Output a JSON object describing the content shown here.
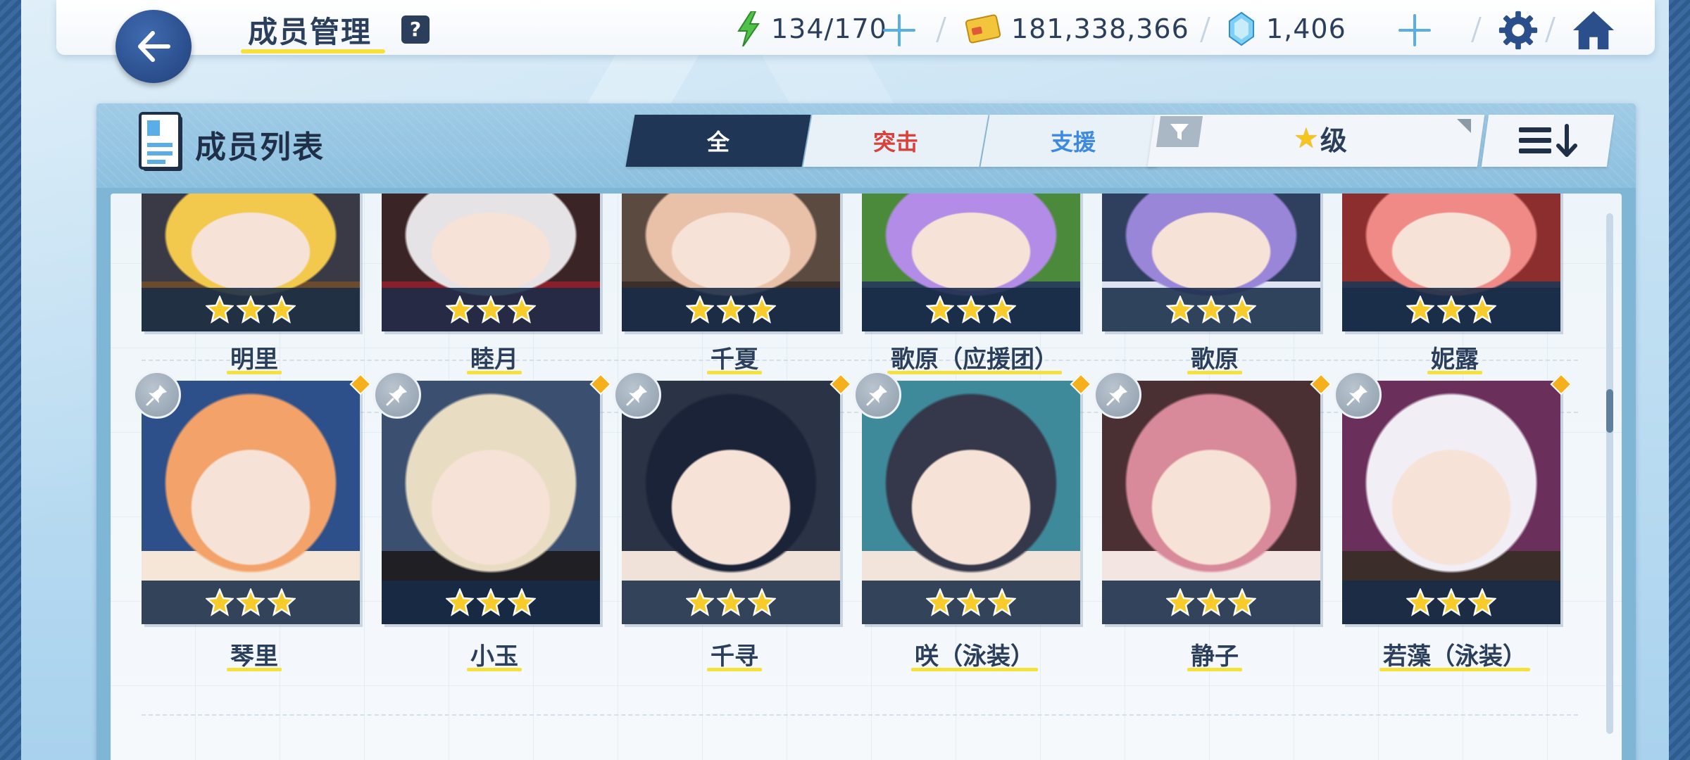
{
  "header": {
    "title": "成员管理",
    "help_label": "?",
    "ap": "134/170",
    "credits": "181,338,366",
    "gems": "1,406"
  },
  "panel": {
    "title": "成员列表",
    "tabs": [
      {
        "label": "全",
        "state": "active"
      },
      {
        "label": "突击",
        "color": "#d8413c"
      },
      {
        "label": "支援",
        "color": "#3d8ae0"
      }
    ],
    "filter_label": "级",
    "filter_icon": "filter-icon",
    "sort_icon": "sort-descending-icon"
  },
  "students_row1": [
    {
      "name": "明里",
      "stars": 3,
      "palette": [
        "#3a3a46",
        "#f2c94c",
        "#6b4a2e"
      ]
    },
    {
      "name": "睦月",
      "stars": 3,
      "palette": [
        "#3b2426",
        "#e6e3e6",
        "#8a1f2b"
      ]
    },
    {
      "name": "千夏",
      "stars": 3,
      "palette": [
        "#5b4a40",
        "#e9c0a8",
        "#3a2f2a"
      ]
    },
    {
      "name": "歌原（应援团）",
      "stars": 3,
      "palette": [
        "#4b8a3a",
        "#b28ce6",
        "#2a3f5a"
      ]
    },
    {
      "name": "歌原",
      "stars": 3,
      "palette": [
        "#2f3f5e",
        "#9a86d9",
        "#dfe3f0"
      ]
    },
    {
      "name": "妮露",
      "stars": 3,
      "palette": [
        "#8c2e2e",
        "#f08a86",
        "#2a3550"
      ]
    }
  ],
  "students_row2": [
    {
      "name": "琴里",
      "stars": 3,
      "palette": [
        "#2d4f8a",
        "#f3a36a",
        "#f5e6d8"
      ]
    },
    {
      "name": "小玉",
      "stars": 3,
      "palette": [
        "#3b5070",
        "#e8dcc2",
        "#1f1f24"
      ]
    },
    {
      "name": "千寻",
      "stars": 3,
      "palette": [
        "#2b3447",
        "#1b2338",
        "#f0e2d8"
      ]
    },
    {
      "name": "咲（泳装）",
      "stars": 3,
      "palette": [
        "#3e8a9a",
        "#34384a",
        "#f2e4da"
      ]
    },
    {
      "name": "静子",
      "stars": 3,
      "palette": [
        "#4a2f33",
        "#d98a9a",
        "#f3e6e2"
      ]
    },
    {
      "name": "若藻（泳装）",
      "stars": 3,
      "palette": [
        "#6a2f5a",
        "#f2eef6",
        "#3a2d2a"
      ]
    }
  ],
  "colors": {
    "accent_yellow": "#f5e13a",
    "navy": "#1f3656",
    "star_gold": "#f5c41f"
  }
}
